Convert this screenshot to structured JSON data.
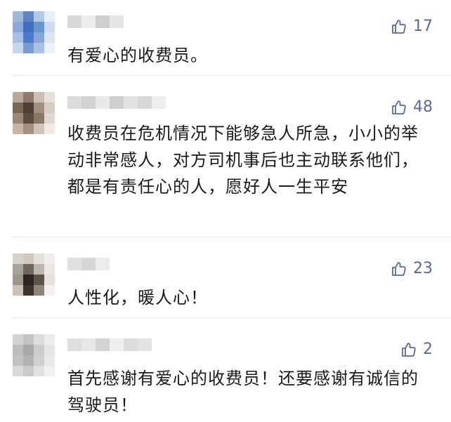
{
  "comments": [
    {
      "likes": "17",
      "text": "有爱心的收费员。",
      "avatar_colors": [
        "#9fb8d8",
        "#5f86c4",
        "#b3c8e6",
        "#e8eef6",
        "#8aaadb",
        "#3f6fc0",
        "#6a93d2",
        "#cfdcee",
        "#a7bfe2",
        "#4a7bcb",
        "#87a7d8",
        "#dde6f2",
        "#c9d7ec",
        "#7a9bd0",
        "#a9c1e3",
        "#eef2f8"
      ],
      "name_colors": [
        "#d9d9d9",
        "#ececec",
        "#cfcfcf",
        "#e6e6e6"
      ]
    },
    {
      "likes": "48",
      "text": "收费员在危机情况下能够急人所急，小小的举动非常感人，对方司机事后也主动联系他们，都是有责任心的人，愿好人一生平安",
      "avatar_colors": [
        "#b9a99b",
        "#8d7c6b",
        "#cbbfb5",
        "#e7e0da",
        "#776555",
        "#4e3e33",
        "#a18f80",
        "#d8ccc3",
        "#9b8878",
        "#5d4b3f",
        "#8a7867",
        "#e1d7d0",
        "#c7b5a8",
        "#a39080",
        "#d2c3b8",
        "#f0e9e4"
      ],
      "name_colors": [
        "#dcdcdc",
        "#d2d2d2",
        "#e9e9e9",
        "#cfcfcf",
        "#e2e2e2",
        "#d8d8d8",
        "#eeeeee"
      ]
    },
    {
      "likes": "23",
      "text": "人性化，暖人心！",
      "avatar_colors": [
        "#d7d2cc",
        "#cfc8c1",
        "#e4e0db",
        "#f0eeeb",
        "#a9a29b",
        "#6f675f",
        "#bdb6af",
        "#ebe8e4",
        "#9f958a",
        "#2b2621",
        "#5c544c",
        "#e6e2de",
        "#c9c2bb",
        "#3a342e",
        "#8d857d",
        "#f3f1ee"
      ],
      "name_colors": [
        "#e0e0e0",
        "#d6d6d6",
        "#ececec"
      ]
    },
    {
      "likes": "2",
      "text": "首先感谢有爱心的收费员！还要感谢有诚信的驾驶员！",
      "avatar_colors": [
        "#d3d3d3",
        "#c4c4c4",
        "#dddddd",
        "#ececec",
        "#bdbdbd",
        "#a9a9a9",
        "#cccccc",
        "#e6e6e6",
        "#c2c2c2",
        "#b3b3b3",
        "#d0d0d0",
        "#e9e9e9",
        "#d9d9d9",
        "#cacaca",
        "#e1e1e1",
        "#f1f1f1"
      ],
      "name_colors": [
        "#dedede",
        "#e8e8e8",
        "#d4d4d4",
        "#eeeeee",
        "#dcdcdc",
        "#e4e4e4"
      ]
    }
  ],
  "theme": {
    "like_color": "#576b95",
    "text_color": "#1a1a1a",
    "divider_color": "#e6e6e6"
  },
  "icons": {
    "like": "thumbs-up-outline-icon"
  }
}
